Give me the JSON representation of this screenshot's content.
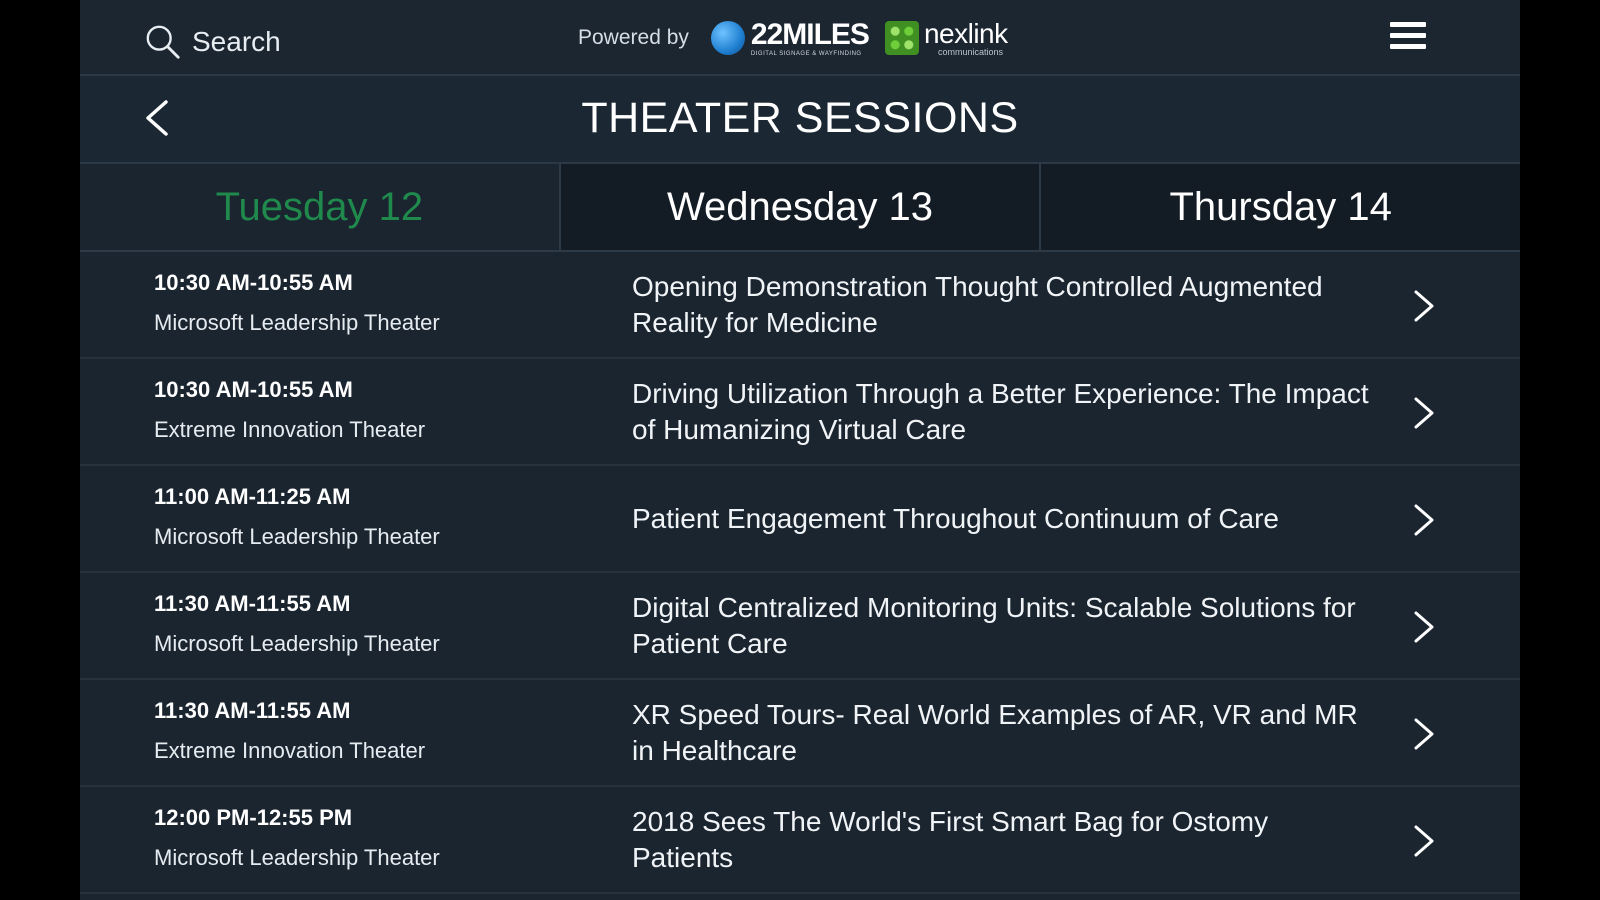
{
  "topbar": {
    "search_label": "Search",
    "powered_by": "Powered by",
    "logo_22miles": "22MILES",
    "logo_22miles_tagline": "DIGITAL SIGNAGE & WAYFINDING",
    "logo_nexlink": "nexlink",
    "logo_nexlink_tagline": "communications"
  },
  "header": {
    "title": "THEATER SESSIONS"
  },
  "tabs": [
    {
      "label": "Tuesday 12",
      "active": true
    },
    {
      "label": "Wednesday 13",
      "active": false
    },
    {
      "label": "Thursday 14",
      "active": false
    }
  ],
  "sessions": [
    {
      "time": "10:30 AM-10:55 AM",
      "venue": "Microsoft Leadership Theater",
      "title": " Opening Demonstration Thought Controlled Augmented Reality for Medicine"
    },
    {
      "time": "10:30 AM-10:55 AM",
      "venue": "Extreme Innovation Theater",
      "title": "Driving Utilization Through a Better Experience: The Impact of Humanizing Virtual Care"
    },
    {
      "time": "11:00 AM-11:25 AM",
      "venue": "Microsoft Leadership Theater",
      "title": "Patient Engagement Throughout Continuum of Care"
    },
    {
      "time": "11:30 AM-11:55 AM",
      "venue": "Microsoft Leadership Theater",
      "title": "Digital Centralized Monitoring Units: Scalable Solutions for Patient Care"
    },
    {
      "time": "11:30 AM-11:55 AM",
      "venue": "Extreme Innovation Theater",
      "title": " XR Speed Tours- Real World Examples of AR, VR and MR in Healthcare"
    },
    {
      "time": "12:00 PM-12:55 PM",
      "venue": "Microsoft Leadership Theater",
      "title": "2018 Sees The World's First Smart Bag for Ostomy Patients"
    }
  ],
  "colors": {
    "background": "#1b2530",
    "active_tab_text": "#1f8a4c",
    "inactive_tab_bg": "#131c25",
    "text": "#ffffff"
  },
  "icons": {
    "search": "search-icon",
    "menu": "hamburger-menu-icon",
    "back": "chevron-left-icon",
    "row_arrow": "chevron-right-icon"
  }
}
